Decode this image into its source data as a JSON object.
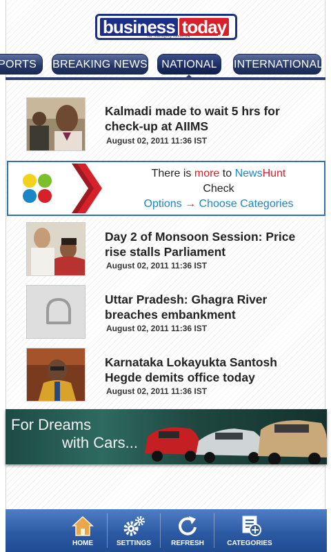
{
  "header": {
    "logo_part1": "business",
    "logo_part2": "today",
    "logo_tagline": "for managing tomorrow"
  },
  "tabs": [
    {
      "label": "PORTS",
      "active": false
    },
    {
      "label": "BREAKING NEWS",
      "active": false
    },
    {
      "label": "NATIONAL",
      "active": true
    },
    {
      "label": "INTERNATIONAL",
      "active": false
    }
  ],
  "news": [
    {
      "title": "Kalmadi made to wait 5 hrs for check-up at AIIMS",
      "date": "August 02, 2011 11:36 IST",
      "thumb": "photo-men"
    },
    {
      "title": "Day 2 of Monsoon Session: Price rise stalls Parliament",
      "date": "August 02, 2011 11:36 IST",
      "thumb": "photo-politicians"
    },
    {
      "title": "Uttar Pradesh: Ghagra River breaches embankment",
      "date": "August 02, 2011 11:36 IST",
      "thumb": "placeholder-icon"
    },
    {
      "title": "Karnataka Lokayukta Santosh Hegde demits office today",
      "date": "August 02, 2011 11:36 IST",
      "thumb": "photo-speaker"
    }
  ],
  "promo": {
    "line1_a": "There is ",
    "line1_b": "more",
    "line1_c": " to ",
    "line1_d": "News",
    "line1_e": "Hunt",
    "line2": "Check",
    "line3_a": "Options",
    "line3_b": " → ",
    "line3_c": "Choose Categories"
  },
  "ad": {
    "line1": "For Dreams",
    "line2": "with Cars..."
  },
  "bottom_nav": [
    {
      "label": "HOME",
      "icon": "home-icon"
    },
    {
      "label": "SETTINGS",
      "icon": "gear-icon"
    },
    {
      "label": "REFRESH",
      "icon": "refresh-icon"
    },
    {
      "label": "CATEGORIES",
      "icon": "categories-icon"
    }
  ],
  "colors": {
    "brand_blue": "#1c2f86",
    "brand_red": "#d6202a",
    "tab_blue": "#243766",
    "bottom_bar": "#2d5aa4",
    "home_icon": "#e8a74a"
  }
}
